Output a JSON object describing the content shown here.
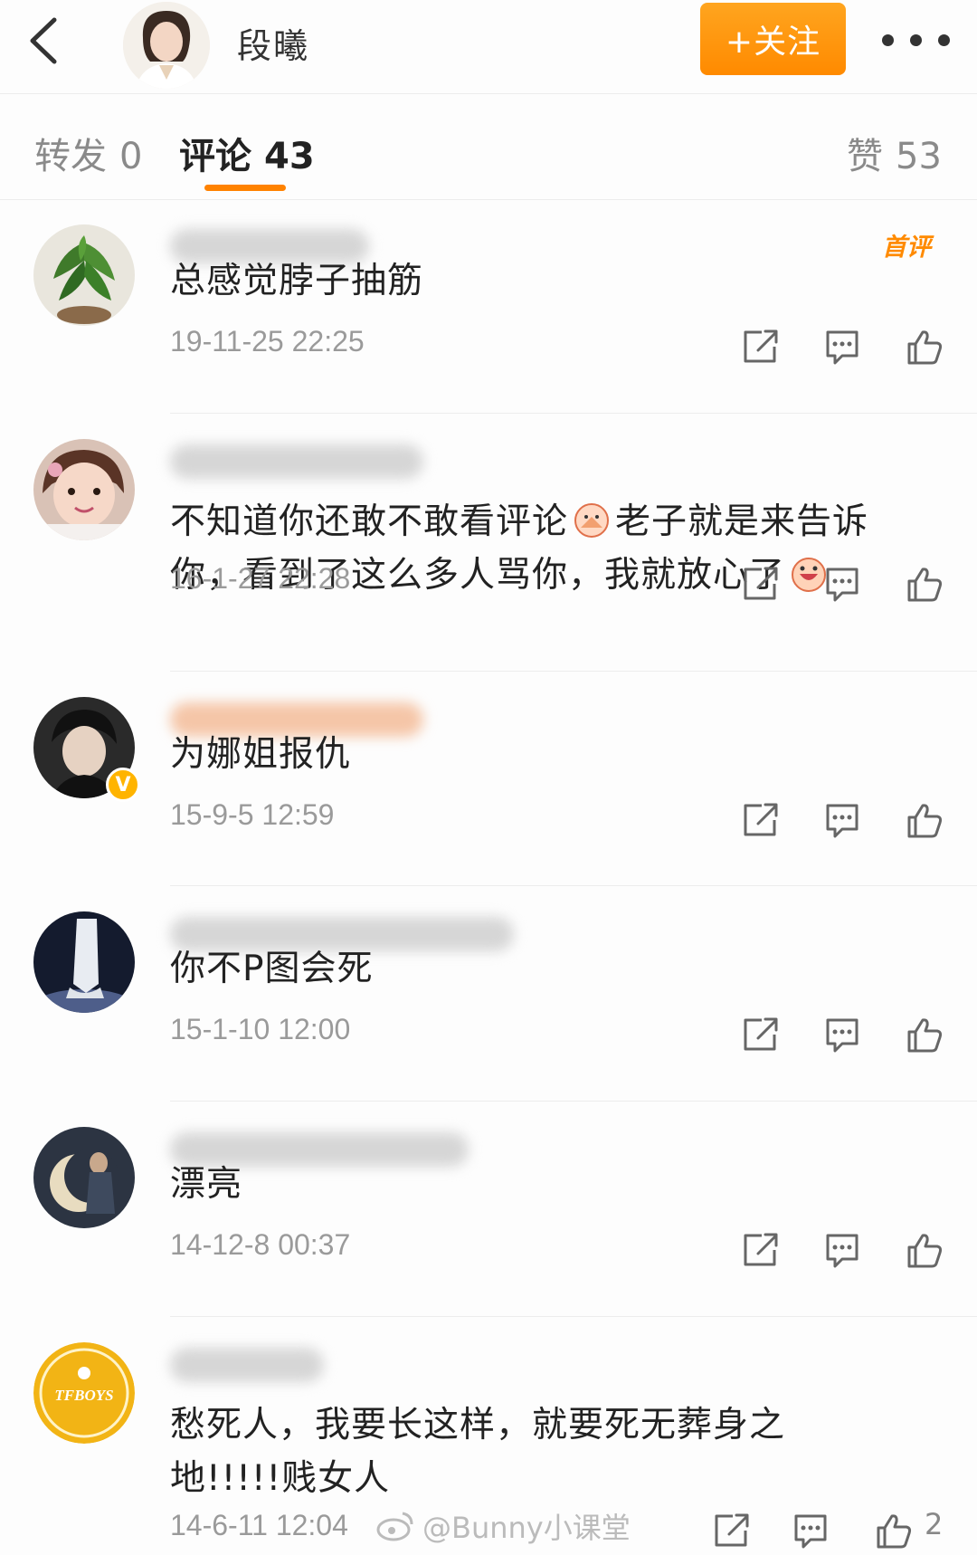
{
  "header": {
    "back_icon": "chevron-left-icon",
    "author": "段曦",
    "follow_label": "+关注",
    "more_icon": "more-dots-icon",
    "accent": "#ff8200"
  },
  "tabs": [
    {
      "label": "转发",
      "count": "0"
    },
    {
      "label": "评论",
      "count": "43"
    },
    {
      "label": "赞",
      "count": "53"
    }
  ],
  "first_comment_badge": "首评",
  "comments": [
    {
      "text": "总感觉脖子抽筋",
      "time": "19-11-25 22:25",
      "likes": ""
    },
    {
      "text_a": "不知道你还敢不敢看评论",
      "text_b": "老子就是来告诉你，看到了这么多人骂你，我就放心了",
      "time": "16-1-27 22:28",
      "likes": ""
    },
    {
      "text": "为娜姐报仇",
      "time": "15-9-5 12:59",
      "likes": "",
      "verified_mark": "V"
    },
    {
      "text": "你不P图会死",
      "time": "15-1-10 12:00",
      "likes": ""
    },
    {
      "text": "漂亮",
      "time": "14-12-8 00:37",
      "likes": ""
    },
    {
      "text": "愁死人，我要长这样，就要死无葬身之地!!!!!贱女人",
      "time": "14-6-11 12:04",
      "likes": "2",
      "avatar_text": "TFBOYS"
    }
  ],
  "watermark": "@Bunny小课堂"
}
